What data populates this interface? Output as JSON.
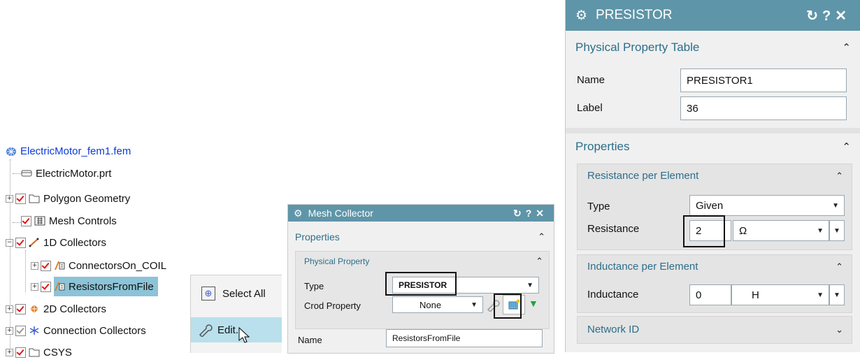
{
  "tree": {
    "root": "ElectricMotor_fem1.fem",
    "items": [
      {
        "label": "ElectricMotor.prt",
        "icon": "part-file-icon"
      },
      {
        "label": "Polygon Geometry",
        "icon": "folder-icon"
      },
      {
        "label": "Mesh Controls",
        "icon": "mesh-controls-icon"
      },
      {
        "label": "1D Collectors",
        "icon": "1d-collector-icon"
      },
      {
        "label": "ConnectorsOn_COIL",
        "icon": "mesh-collector-icon"
      },
      {
        "label": "ResistorsFromFile",
        "icon": "mesh-collector-icon"
      },
      {
        "label": "2D Collectors",
        "icon": "2d-collector-icon"
      },
      {
        "label": "Connection Collectors",
        "icon": "connection-icon"
      },
      {
        "label": "CSYS",
        "icon": "folder-icon"
      }
    ]
  },
  "context_menu": {
    "items": [
      {
        "label": "Select All",
        "icon": "select-all-icon"
      },
      {
        "label": "Edit...",
        "icon": "wrench-icon"
      }
    ]
  },
  "mesh_collector": {
    "title": "Mesh Collector",
    "buttons": [
      "reset-icon",
      "help-icon",
      "close-icon"
    ],
    "properties_label": "Properties",
    "physical_property_label": "Physical Property",
    "type_label": "Type",
    "type_value": "PRESISTOR",
    "crod_label": "Crod Property",
    "crod_value": "None",
    "name_label": "Name",
    "name_value": "ResistorsFromFile"
  },
  "presistor": {
    "title": "PRESISTOR",
    "table_label": "Physical Property Table",
    "name_label": "Name",
    "name_value": "PRESISTOR1",
    "label_label": "Label",
    "label_value": "36",
    "properties_label": "Properties",
    "resistance_group": "Resistance per Element",
    "type_label": "Type",
    "type_value": "Given",
    "resistance_label": "Resistance",
    "resistance_value": "2",
    "resistance_unit": "Ω",
    "inductance_group": "Inductance per Element",
    "inductance_label": "Inductance",
    "inductance_value": "0",
    "inductance_unit": "H",
    "network_label": "Network ID"
  },
  "colors": {
    "titlebar": "#5f95a8",
    "section_text": "#2c6e8a",
    "selection": "#8cc3d6",
    "check": "#e01515"
  }
}
